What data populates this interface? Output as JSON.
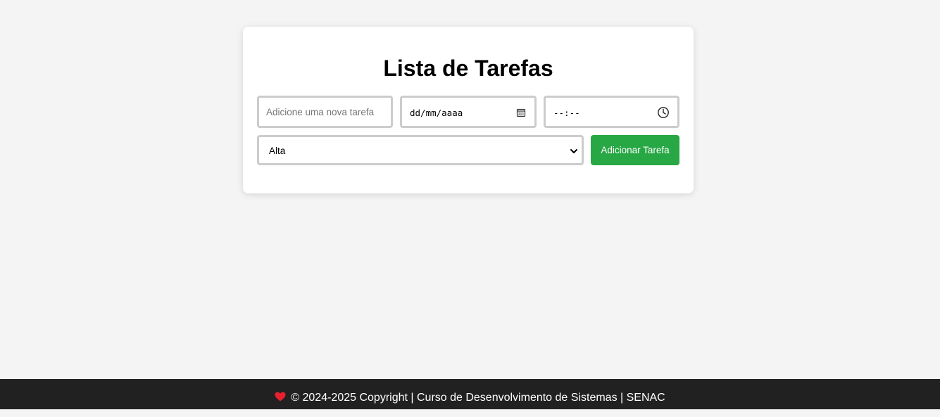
{
  "card": {
    "title": "Lista de Tarefas"
  },
  "form": {
    "task_placeholder": "Adicione uma nova tarefa",
    "date_placeholder": "dd/mm/aaaa",
    "time_placeholder": "--:--",
    "priority_selected": "Alta",
    "add_button_label": "Adicionar Tarefa"
  },
  "footer": {
    "text": "© 2024-2025 Copyright | Curso de Desenvolvimento de Sistemas | SENAC"
  },
  "colors": {
    "background": "#f4f4f4",
    "card": "#ffffff",
    "button": "#28a745",
    "footer": "#212121",
    "heart": "#e8202e"
  },
  "icons": {
    "date": "calendar-icon",
    "time": "clock-icon",
    "select": "chevron-down-icon",
    "footer": "heart-icon"
  }
}
